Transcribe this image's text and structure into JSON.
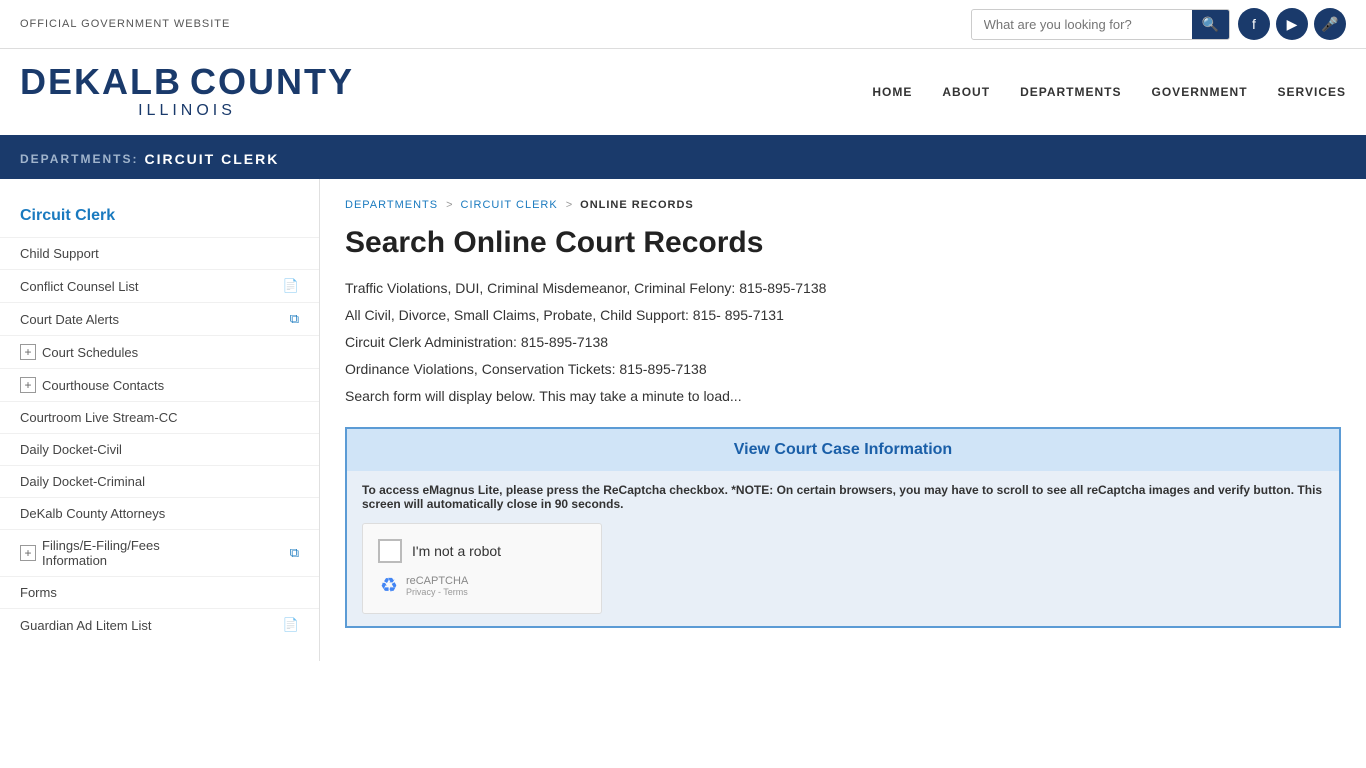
{
  "topbar": {
    "official_text": "OFFICIAL GOVERNMENT WEBSITE",
    "search_placeholder": "What are you looking for?"
  },
  "logo": {
    "dekalb": "DEKALB",
    "county": "COUNTY",
    "illinois": "ILLINOIS"
  },
  "nav": {
    "items": [
      {
        "label": "HOME"
      },
      {
        "label": "ABOUT"
      },
      {
        "label": "DEPARTMENTS"
      },
      {
        "label": "GOVERNMENT"
      },
      {
        "label": "SERVICES"
      }
    ]
  },
  "dept_bar": {
    "label": "DEPARTMENTS:",
    "name": "CIRCUIT CLERK"
  },
  "sidebar": {
    "title": "Circuit Clerk",
    "items": [
      {
        "label": "Child Support",
        "icon": null,
        "has_plus": false
      },
      {
        "label": "Conflict Counsel List",
        "icon": "pdf",
        "has_plus": false
      },
      {
        "label": "Court Date Alerts",
        "icon": "ext",
        "has_plus": false
      },
      {
        "label": "Court Schedules",
        "icon": null,
        "has_plus": true
      },
      {
        "label": "Courthouse Contacts",
        "icon": null,
        "has_plus": true
      },
      {
        "label": "Courtroom Live Stream-CC",
        "icon": null,
        "has_plus": false
      },
      {
        "label": "Daily Docket-Civil",
        "icon": null,
        "has_plus": false
      },
      {
        "label": "Daily Docket-Criminal",
        "icon": null,
        "has_plus": false
      },
      {
        "label": "DeKalb County Attorneys",
        "icon": null,
        "has_plus": false
      },
      {
        "label": "Filings/E-Filing/Fees Information",
        "icon": "ext",
        "has_plus": true
      },
      {
        "label": "Forms",
        "icon": null,
        "has_plus": false
      },
      {
        "label": "Guardian Ad Litem List",
        "icon": "pdf",
        "has_plus": false
      }
    ]
  },
  "breadcrumb": {
    "departments": "DEPARTMENTS",
    "circuit_clerk": "CIRCUIT CLERK",
    "current": "ONLINE RECORDS"
  },
  "main": {
    "page_title": "Search Online Court Records",
    "contact_lines": [
      "Traffic Violations, DUI, Criminal Misdemeanor, Criminal Felony: 815-895-7138",
      "All Civil, Divorce, Small Claims, Probate, Child Support: 815- 895-7131",
      "Circuit Clerk Administration: 815-895-7138",
      "Ordinance Violations, Conservation Tickets: 815-895-7138",
      "Search form will display below.  This may take a minute to load..."
    ],
    "court_records_link": "View Court Case Information",
    "recaptcha_instruction": "To access eMagnus Lite, please press the ReCaptcha checkbox. *NOTE: On certain browsers, you may have to scroll to see all reCaptcha images and verify button. This screen will automatically close in 90 seconds.",
    "im_not_robot": "I'm not a robot",
    "recaptcha_label": "reCAPTCHA",
    "recaptcha_privacy": "Privacy - Terms"
  }
}
